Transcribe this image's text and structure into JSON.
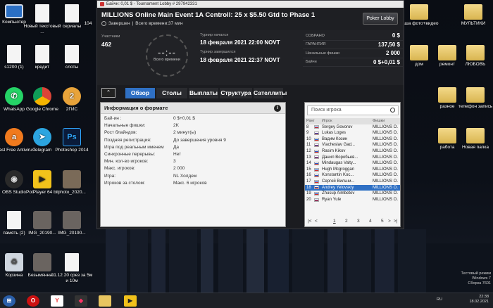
{
  "desktop": {
    "icons_left": [
      {
        "label": "Компьютер",
        "glyph": "monitor"
      },
      {
        "label": "Новый текстовый ...",
        "glyph": "doc"
      },
      {
        "label": "сериалы",
        "glyph": "doc"
      },
      {
        "label": "s1200 (1)",
        "glyph": "doc"
      },
      {
        "label": "кредит",
        "glyph": "doc"
      },
      {
        "label": "слоты",
        "glyph": "doc"
      },
      {
        "label": "WhatsApp",
        "glyph": "whatsapp"
      },
      {
        "label": "Google Chrome",
        "glyph": "chrome"
      },
      {
        "label": "2ГИС",
        "glyph": "gis"
      },
      {
        "label": "Avast Free Antivirus",
        "glyph": "avast"
      },
      {
        "label": "Telegram",
        "glyph": "telegram"
      },
      {
        "label": "Photoshop 2014",
        "glyph": "ps"
      },
      {
        "label": "OBS Studio",
        "glyph": "obs"
      },
      {
        "label": "PotPlayer 64 bit",
        "glyph": "potplayer"
      },
      {
        "label": "photo_2020...",
        "glyph": "photo"
      },
      {
        "label": "память (2)",
        "glyph": "doc"
      },
      {
        "label": "IMG_20190...",
        "glyph": "img"
      },
      {
        "label": "IMG_20190...",
        "glyph": "img"
      },
      {
        "label": "Корзина",
        "glyph": "bin"
      },
      {
        "label": "Безымянны...",
        "glyph": "img"
      },
      {
        "label": "01.12.20 срез за 5м и 10м",
        "glyph": "doc"
      }
    ],
    "icons_right": [
      {
        "label": "ваша фото+видео",
        "glyph": "folder"
      },
      {
        "label": "МУЛЬТИКИ",
        "glyph": "folder"
      },
      {
        "label": "дом",
        "glyph": "folder"
      },
      {
        "label": "ремонт",
        "glyph": "folder"
      },
      {
        "label": "ЛЮБОВЬ",
        "glyph": "folder"
      },
      {
        "label": "разное",
        "glyph": "folder"
      },
      {
        "label": "телефон запись",
        "glyph": "folder"
      },
      {
        "label": "работа",
        "glyph": "folder"
      },
      {
        "label": "Новая папка",
        "glyph": "folder"
      }
    ],
    "partial_icon_label": "104",
    "windows_note": [
      "Тестовый режим",
      "Windows 7",
      "Сборка 7601"
    ]
  },
  "window": {
    "titlebar": "Байчн: 0,01 $ - Tournament Lobby # 297942331",
    "title": "MILLIONS Online Main Event 1A Centroll: 25 x $5.50 Gtd to Phase 1",
    "status": "Завершен",
    "status_time": "Всего времени:37 мин",
    "lobby_button": "Poker Lobby",
    "participants_label": "Участники",
    "participants_value": "462",
    "timer_digits": "--:--",
    "timer_caption": "Всего времени",
    "start_label": "Турнир начался",
    "start_value": "18 февраля 2021  22:00 NOVT",
    "end_label": "Турнир завершился",
    "end_value": "18 февраля 2021  22:37 NOVT",
    "stats": [
      {
        "k": "СОБРАНО",
        "v": "0 $"
      },
      {
        "k": "ГАРАНТИЯ",
        "v": "137,50 $"
      },
      {
        "k": "Начальные фишки",
        "v": "2 000"
      },
      {
        "k": "Байчн",
        "v": "0 $+0,01 $"
      }
    ],
    "tabs": [
      "Обзор",
      "Столы",
      "Выплаты",
      "Структура",
      "Сателлиты"
    ],
    "collapse_glyph": "⌃",
    "info_title": "Информация о формате",
    "info_rows": [
      {
        "k": "Бай-ин :",
        "v": "0 $+0,01 $"
      },
      {
        "k": "Начальные фишки:",
        "v": "2K"
      },
      {
        "k": "Рост блайндов:",
        "v": "2 минут(ы)"
      },
      {
        "k": "Поздняя регистрация:",
        "v": "До завершения уровня 9"
      },
      {
        "k": "Игра под реальным именем",
        "v": "Да"
      },
      {
        "k": "Синхронные перерывы:",
        "v": "Нет"
      },
      {
        "k": "Мин. кол-во игроков:",
        "v": "3"
      },
      {
        "k": "Макс. игроков:",
        "v": "2 000"
      },
      {
        "k": "Игра:",
        "v": "NL Холдем"
      },
      {
        "k": "Игроков за столом:",
        "v": "Макс. 6 игроков"
      }
    ],
    "search_placeholder": "Поиск игрока",
    "table_headers": [
      "Ранг",
      "Игрок",
      "Фишки"
    ],
    "players": [
      {
        "rank": "8",
        "name": "Sergey Govorov",
        "chips": "MILLIONS O..."
      },
      {
        "rank": "9",
        "name": "Lukas Loges",
        "chips": "MILLIONS O..."
      },
      {
        "rank": "10",
        "name": "Вадим Козин",
        "chips": "MILLIONS O..."
      },
      {
        "rank": "11",
        "name": "Viacheslav Gad...",
        "chips": "MILLIONS O..."
      },
      {
        "rank": "12",
        "name": "Rasim Kikov",
        "chips": "MILLIONS O..."
      },
      {
        "rank": "13",
        "name": "Данил Воробьев...",
        "chips": "MILLIONS O..."
      },
      {
        "rank": "14",
        "name": "Mindaugas Valty...",
        "chips": "MILLIONS O..."
      },
      {
        "rank": "15",
        "name": "Hugh Mcgroggan",
        "chips": "MILLIONS O..."
      },
      {
        "rank": "16",
        "name": "Konstantin Koc...",
        "chips": "MILLIONS O..."
      },
      {
        "rank": "17",
        "name": "Сергей Вильчи...",
        "chips": "MILLIONS O..."
      },
      {
        "rank": "18",
        "name": "Andrey Yelovskiy",
        "chips": "MILLIONS O...",
        "selected": true
      },
      {
        "rank": "19",
        "name": "Zhusup Aimbetov",
        "chips": "MILLIONS O..."
      },
      {
        "rank": "20",
        "name": "Ryan Yule",
        "chips": "MILLIONS O..."
      }
    ],
    "pager": {
      "first": "|<",
      "prev": "<",
      "pages": [
        "1",
        "2",
        "3",
        "4",
        "5"
      ],
      "next": ">",
      "last": ">|"
    }
  },
  "taskbar": {
    "lang": "RU",
    "time": "22:38",
    "date": "18.02.2021"
  },
  "colors": {
    "accent": "#2f70c4",
    "window_bg": "#1b1c20",
    "panel_bg": "#f4f4f4"
  }
}
